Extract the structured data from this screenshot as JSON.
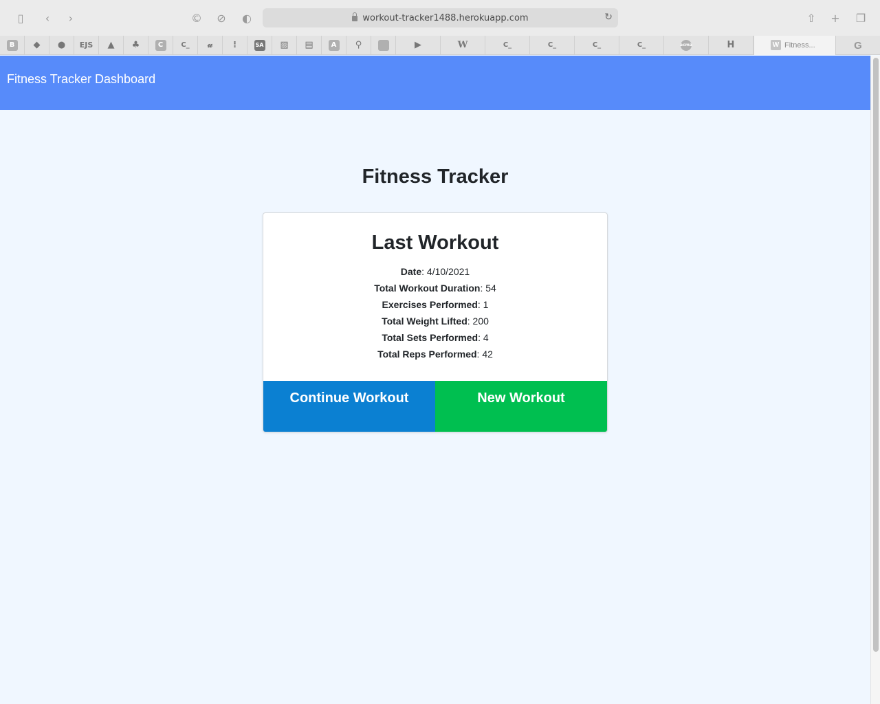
{
  "browser": {
    "url": "workout-tracker1488.herokuapp.com",
    "pinned_tabs": [
      "B",
      "",
      "",
      "EJS",
      "",
      "",
      "C",
      "C_",
      "",
      "",
      "SA",
      "",
      "",
      "A",
      "",
      "",
      "",
      "W",
      "C_",
      "C_",
      "C_",
      "C_",
      "acma",
      "H"
    ],
    "active_tab_title": "Fitness...",
    "active_tab_favicon": "W"
  },
  "navbar": {
    "brand": "Fitness Tracker Dashboard",
    "color": "#578bfa"
  },
  "main": {
    "heading": "Fitness Tracker",
    "card": {
      "title": "Last Workout",
      "stats": [
        {
          "label": "Date",
          "value": "4/10/2021"
        },
        {
          "label": "Total Workout Duration",
          "value": "54"
        },
        {
          "label": "Exercises Performed",
          "value": "1"
        },
        {
          "label": "Total Weight Lifted",
          "value": "200"
        },
        {
          "label": "Total Sets Performed",
          "value": "4"
        },
        {
          "label": "Total Reps Performed",
          "value": "42"
        }
      ],
      "continue_label": "Continue Workout",
      "new_label": "New Workout",
      "continue_color": "#0b80d2",
      "new_color": "#00bf50"
    }
  }
}
